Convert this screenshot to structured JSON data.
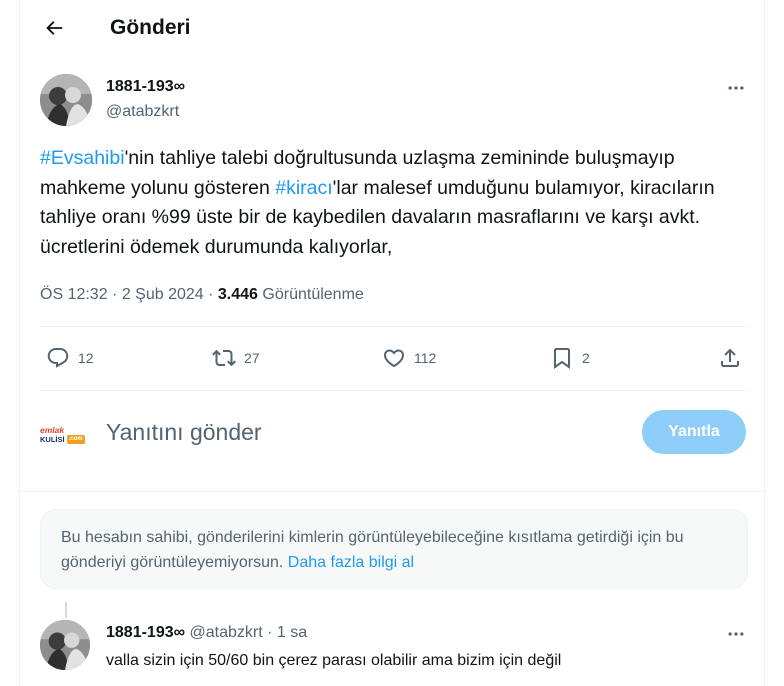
{
  "header": {
    "title": "Gönderi"
  },
  "tweet": {
    "author_name": "1881-193∞",
    "author_handle": "@atabzkrt",
    "text": [
      {
        "t": "#Evsahibi",
        "tag": true
      },
      {
        "t": "'nin tahliye talebi doğrultusunda uzlaşma zemininde buluşmayıp mahkeme yolunu gösteren ",
        "tag": false
      },
      {
        "t": "#kiracı",
        "tag": true
      },
      {
        "t": "'lar malesef umduğunu bulamıyor, kiracıların  tahliye oranı %99 üste bir de kaybedilen davaların masraflarını ve karşı avkt. ücretlerini ödemek durumunda kalıyorlar,",
        "tag": false
      }
    ],
    "meta": {
      "time": "ÖS 12:32",
      "date": "2 Şub 2024",
      "views": "3.446",
      "views_label": "Görüntülenme"
    },
    "actions": {
      "replies": "12",
      "reposts": "27",
      "likes": "112",
      "bookmarks": "2"
    }
  },
  "compose": {
    "avatar_logo_top": "emlak",
    "avatar_logo_bottom": "KULİSİ",
    "avatar_logo_badge": ".com",
    "placeholder": "Yanıtını gönder",
    "button_label": "Yanıtla"
  },
  "notice": {
    "text": "Bu hesabın sahibi, gönderilerini kimlerin görüntüleyebileceğine kısıtlama getirdiği için bu gönderiyi görüntüleyemiyorsun.",
    "link": "Daha fazla bilgi al"
  },
  "reply": {
    "author_name": "1881-193∞",
    "author_handle": "@atabzkrt",
    "separator": "·",
    "time": "1 sa",
    "text": "valla sizin için 50/60 bin çerez parası olabilir ama bizim için değil"
  },
  "colors": {
    "accent": "#1d9bf0",
    "button_disabled": "#8ecdf8",
    "secondary_text": "#536471"
  }
}
